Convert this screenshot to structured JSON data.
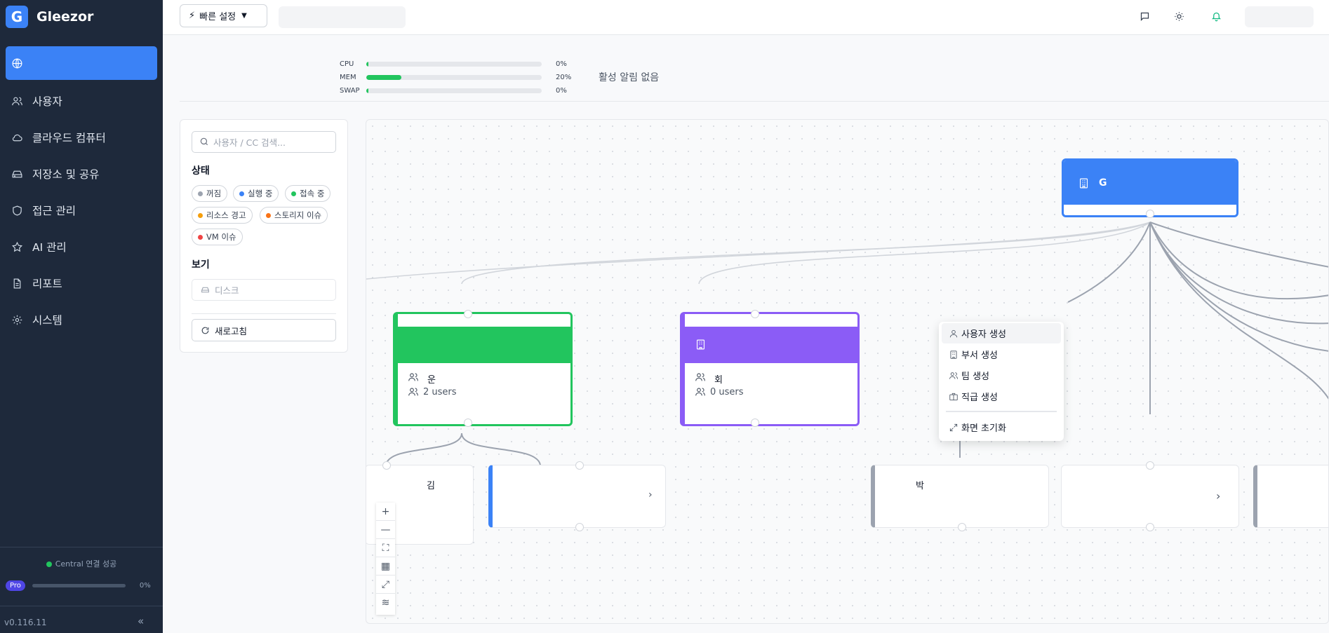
{
  "app": {
    "logo_letter": "G",
    "name": "Gleezor",
    "version": "v0.116.11"
  },
  "sidebar": {
    "items": [
      {
        "label": "",
        "icon": "globe-icon",
        "active": true
      },
      {
        "label": "사용자",
        "icon": "users-icon"
      },
      {
        "label": "클라우드 컴퓨터",
        "icon": "cloud-icon"
      },
      {
        "label": "저장소 및 공유",
        "icon": "hard-drive-icon"
      },
      {
        "label": "접근 관리",
        "icon": "shield-icon"
      },
      {
        "label": "AI 관리",
        "icon": "star-icon"
      },
      {
        "label": "리포트",
        "icon": "file-icon"
      },
      {
        "label": "시스템",
        "icon": "gear-icon"
      }
    ],
    "connection_status": "Central 연결 성공",
    "plan_badge": "Pro",
    "plan_usage_pct": "0%",
    "collapse_glyph": "«"
  },
  "topbar": {
    "quick_settings_label": "빠른 설정"
  },
  "metrics": {
    "rows": [
      {
        "label": "CPU",
        "pct_text": "0%",
        "value": 0.01
      },
      {
        "label": "MEM",
        "pct_text": "20%",
        "value": 0.2
      },
      {
        "label": "SWAP",
        "pct_text": "0%",
        "value": 0.01
      }
    ],
    "alerts_text": "활성 알림 없음"
  },
  "filters": {
    "search_placeholder": "사용자 / CC 검색...",
    "status_title": "상태",
    "status_chips": [
      {
        "label": "꺼짐",
        "color": "#9ca3af"
      },
      {
        "label": "실행 중",
        "color": "#3b82f6"
      },
      {
        "label": "접속 중",
        "color": "#22c55e"
      },
      {
        "label": "리소스 경고",
        "color": "#f59e0b"
      },
      {
        "label": "스토리지 이슈",
        "color": "#f97316"
      },
      {
        "label": "VM 이슈",
        "color": "#ef4444"
      }
    ],
    "view_title": "보기",
    "view_select": "디스크",
    "refresh_label": "새로고침"
  },
  "canvas": {
    "root_node": {
      "label": "G",
      "color": "#3b82f6"
    },
    "dept_nodes": [
      {
        "name": "운",
        "users_text": "2 users",
        "color": "#22c55e"
      },
      {
        "name": "회",
        "users_text": "0 users",
        "color": "#8b5cf6"
      }
    ],
    "user_nodes": [
      {
        "name": "김"
      },
      {
        "name": "박"
      }
    ],
    "context_menu": [
      {
        "label": "사용자 생성",
        "icon": "user-icon"
      },
      {
        "label": "부서 생성",
        "icon": "building-icon"
      },
      {
        "label": "팀 생성",
        "icon": "users-icon"
      },
      {
        "label": "직급 생성",
        "icon": "briefcase-icon"
      },
      {
        "label": "화면 초기화",
        "icon": "expand-icon"
      }
    ],
    "controls": [
      "zoom-in-icon",
      "zoom-out-icon",
      "fit-view-icon",
      "grid-icon",
      "expand-icon",
      "layout-icon"
    ]
  }
}
